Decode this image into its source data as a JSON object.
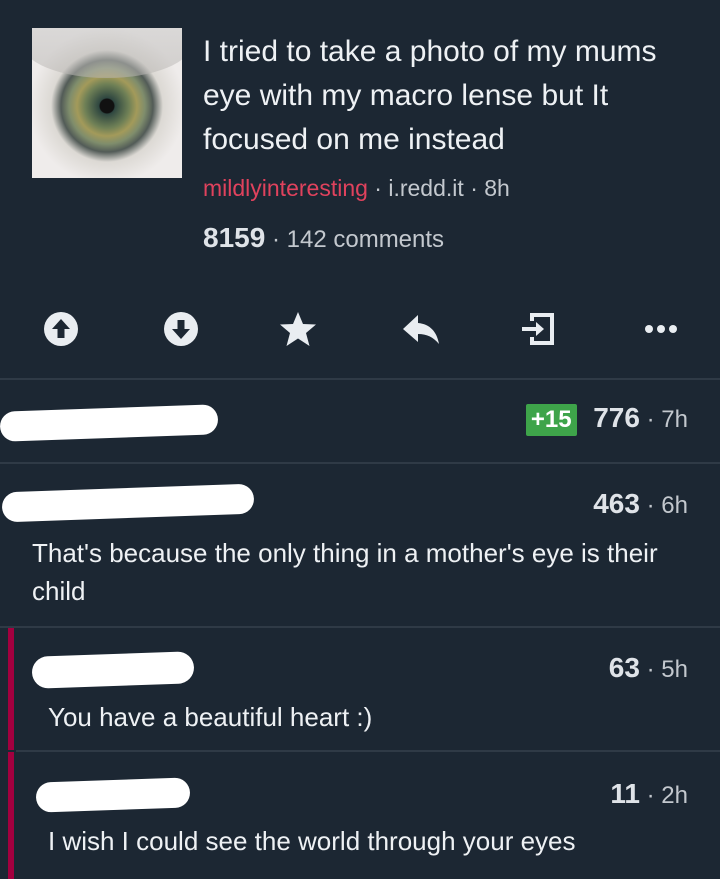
{
  "post": {
    "title": "I tried to take a photo of my mums eye with my macro lense but It focused on me instead",
    "subreddit": "mildlyinteresting",
    "domain": "i.redd.it",
    "age": "8h",
    "score": "8159",
    "comments": "142 comments"
  },
  "actions": [
    "upvote-icon",
    "downvote-icon",
    "star-icon",
    "reply-icon",
    "share-icon",
    "more-icon"
  ],
  "colors": {
    "background": "#1c2733",
    "subreddit": "#e0425d",
    "gilded_badge": "#3ea44a",
    "thread_bar": "#a3003f"
  },
  "comments": [
    {
      "author": "",
      "badge": "+15",
      "score": "776",
      "age": "7h",
      "text": ""
    },
    {
      "author": "",
      "score": "463",
      "age": "6h",
      "text": "That's because the only thing in a mother's eye is their child"
    },
    {
      "author": "",
      "score": "63",
      "age": "5h",
      "text": "You have a beautiful heart :)"
    },
    {
      "author": "",
      "score": "11",
      "age": "2h",
      "text": "I wish I could see the world through your eyes"
    }
  ],
  "sep": "·"
}
